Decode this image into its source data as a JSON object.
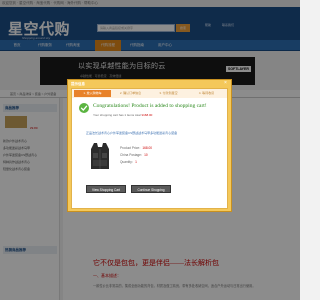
{
  "topbar": {
    "text": "欢迎您到 · 星空代购 · 淘宝代购 · 代购网 · 海外代购 · 帮助中心"
  },
  "header": {
    "logo": "星空代购",
    "logo_sub": "Shopping around sky",
    "search_placeholder": "请输入商品链接或关键字",
    "search_button": "搜索",
    "links": [
      "帮助",
      "联系我们"
    ]
  },
  "nav": {
    "items": [
      "首页",
      "代购服务",
      "代购淘宝",
      "代购流程",
      "代购指南",
      "用户中心"
    ],
    "active_index": 3
  },
  "banner": {
    "slogan": "以实现卓越性能为目标的云",
    "slogan_sub": "卓越性能 · 可靠稳定 · 高效便捷",
    "brand": "SOFTLAYER"
  },
  "breadcrumb": "首页 > 商品详情 > 装备 > 户外装备",
  "left_col": {
    "section1": "商品推荐",
    "price": "¥9.80",
    "lines": [
      "新款户外战术背心",
      "多功能迷彩战术马甲",
      "户外军迷装备CS野战背心",
      "特种兵作战战术背心",
      "轻量化战术背心装备"
    ],
    "section2": "热销商品推荐"
  },
  "main": {
    "desc_title": "它不仅是包包，更是伴侣——法长解析包",
    "desc_sub": "一、基本描述：",
    "desc_text": "一款性价比非常高的，集成全面功能的背包，材质及做工精良，带有多处收纳空间，适合户外运动与日常出行使用。"
  },
  "dialog": {
    "title": "提示信息",
    "close": "×",
    "steps": [
      "1. 放入购物车",
      "2. 确认订单信息",
      "3. 付款到星空",
      "4. 等待收货"
    ],
    "current_step": 0,
    "congrats": "Congratulations! Product is added to shopping cart!",
    "cart_summary_prefix": "Your shopping cart has 1 items  total",
    "cart_amount": "¥168.00",
    "product_name": "正品法长战术背心户外军迷装备CS野战战术马甲多功能迷彩背心装备",
    "price_label": "Product Price：",
    "price_value": "168.00",
    "freight_label": "China Postage：",
    "freight_value": "10",
    "quantity_label": "Quantity：",
    "quantity_value": "1",
    "view_cart": "View Shopping Cart",
    "continue": "Continue Shopping"
  },
  "colors": {
    "header_blue": "#1d4f88",
    "nav_blue": "#2c6fb5",
    "active_orange": "#e68a1b",
    "dialog_frame": "#f4c85a",
    "success_green": "#2c8a1e",
    "price_red": "#c00000"
  }
}
